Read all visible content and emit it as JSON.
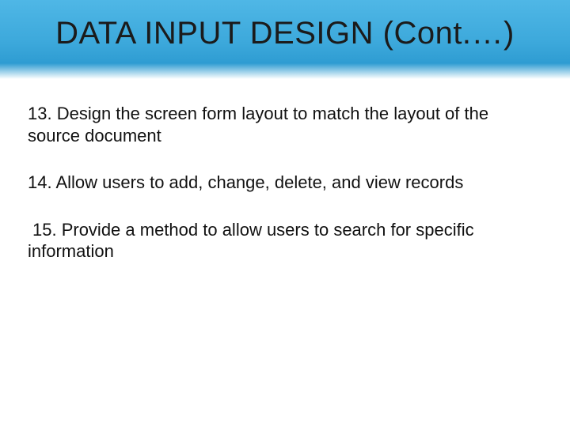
{
  "slide": {
    "title": "DATA INPUT DESIGN (Cont.…)",
    "items": [
      "13. Design the screen form layout to match the layout of the source document",
      "14. Allow users to add, change, delete, and view records",
      " 15. Provide a method to allow users to search for specific information"
    ]
  }
}
